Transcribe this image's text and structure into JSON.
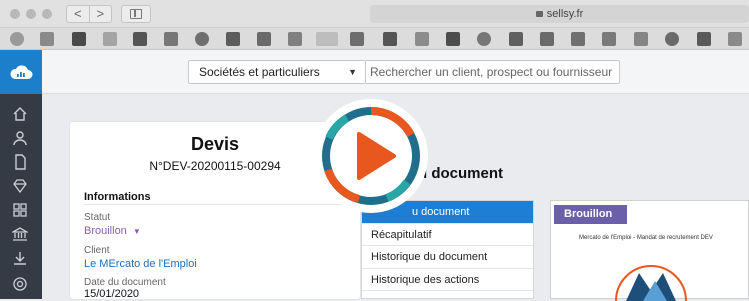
{
  "browser": {
    "url": "sellsy.fr",
    "back": "<",
    "forward": ">"
  },
  "topbar": {
    "select_label": "Sociétés et particuliers",
    "search_placeholder": "Rechercher un client, prospect ou fournisseur"
  },
  "document": {
    "title": "Devis",
    "number": "N°DEV-20200115-00294",
    "info_heading": "Informations",
    "status_label": "Statut",
    "status_value": "Brouillon",
    "client_label": "Client",
    "client_value": "Le MErcato de l'Emploi",
    "date_label": "Date du document",
    "date_value": "15/01/2020"
  },
  "section": {
    "title": "u document"
  },
  "menu": {
    "items": [
      {
        "label": "u document"
      },
      {
        "label": "Récapitulatif"
      },
      {
        "label": "Historique du document"
      },
      {
        "label": "Historique des actions"
      }
    ]
  },
  "preview": {
    "badge": "Brouillon",
    "text": "Mercato de l'Emploi - Mandat de recrutement DEV"
  },
  "colors": {
    "brand_blue": "#1d7ed4",
    "sidebar_dark": "#353b44",
    "status_purple": "#8a5fb3",
    "link_blue": "#1d6fb8",
    "play_orange": "#e8571e",
    "badge_purple": "#6a5fa8"
  },
  "icons": {
    "play": "play-icon",
    "logo": "cloud-logo-icon"
  }
}
